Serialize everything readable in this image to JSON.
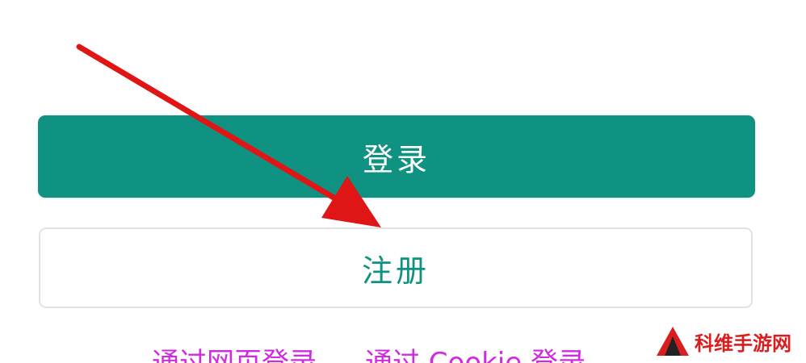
{
  "buttons": {
    "login_label": "登录",
    "register_label": "注册"
  },
  "alt_login": {
    "web_label": "通过网页登录",
    "cookie_label": "通过 Cookie 登录"
  },
  "watermark": {
    "text": "科维手游网"
  },
  "colors": {
    "primary": "#0f9281",
    "alt_link": "#d12be1",
    "arrow": "#e01515",
    "watermark": "#d81e1e"
  },
  "annotation": {
    "icon": "red-arrow-icon"
  }
}
